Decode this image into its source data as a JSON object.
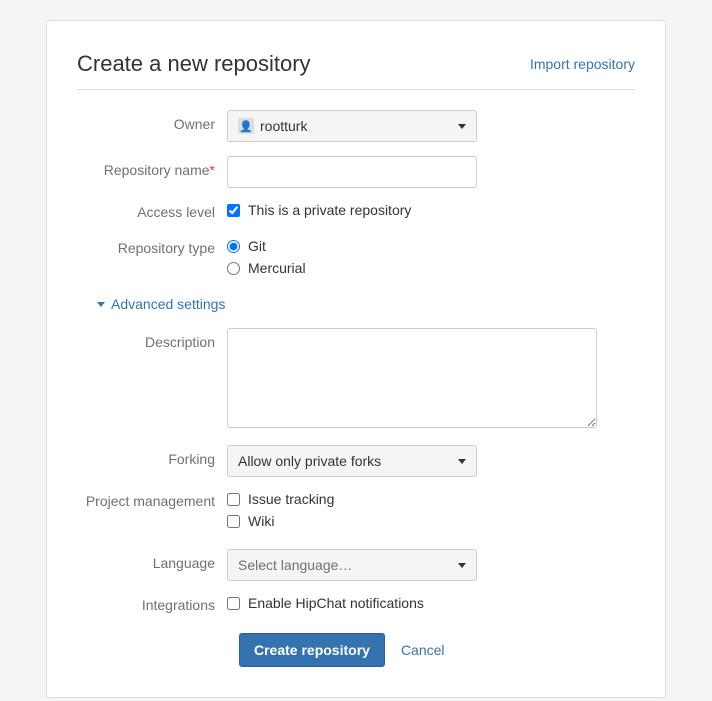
{
  "header": {
    "title": "Create a new repository",
    "import_link": "Import repository"
  },
  "form": {
    "owner": {
      "label": "Owner",
      "value": "rootturk"
    },
    "repo_name": {
      "label": "Repository name",
      "value": ""
    },
    "access_level": {
      "label": "Access level",
      "checkbox": "This is a private repository",
      "checked": true
    },
    "repo_type": {
      "label": "Repository type",
      "options": [
        "Git",
        "Mercurial"
      ],
      "selected": "Git"
    },
    "advanced_toggle": "Advanced settings",
    "description": {
      "label": "Description",
      "value": ""
    },
    "forking": {
      "label": "Forking",
      "value": "Allow only private forks"
    },
    "project_mgmt": {
      "label": "Project management",
      "options": [
        "Issue tracking",
        "Wiki"
      ]
    },
    "language": {
      "label": "Language",
      "placeholder": "Select language…"
    },
    "integrations": {
      "label": "Integrations",
      "checkbox": "Enable HipChat notifications"
    }
  },
  "actions": {
    "submit": "Create repository",
    "cancel": "Cancel"
  }
}
